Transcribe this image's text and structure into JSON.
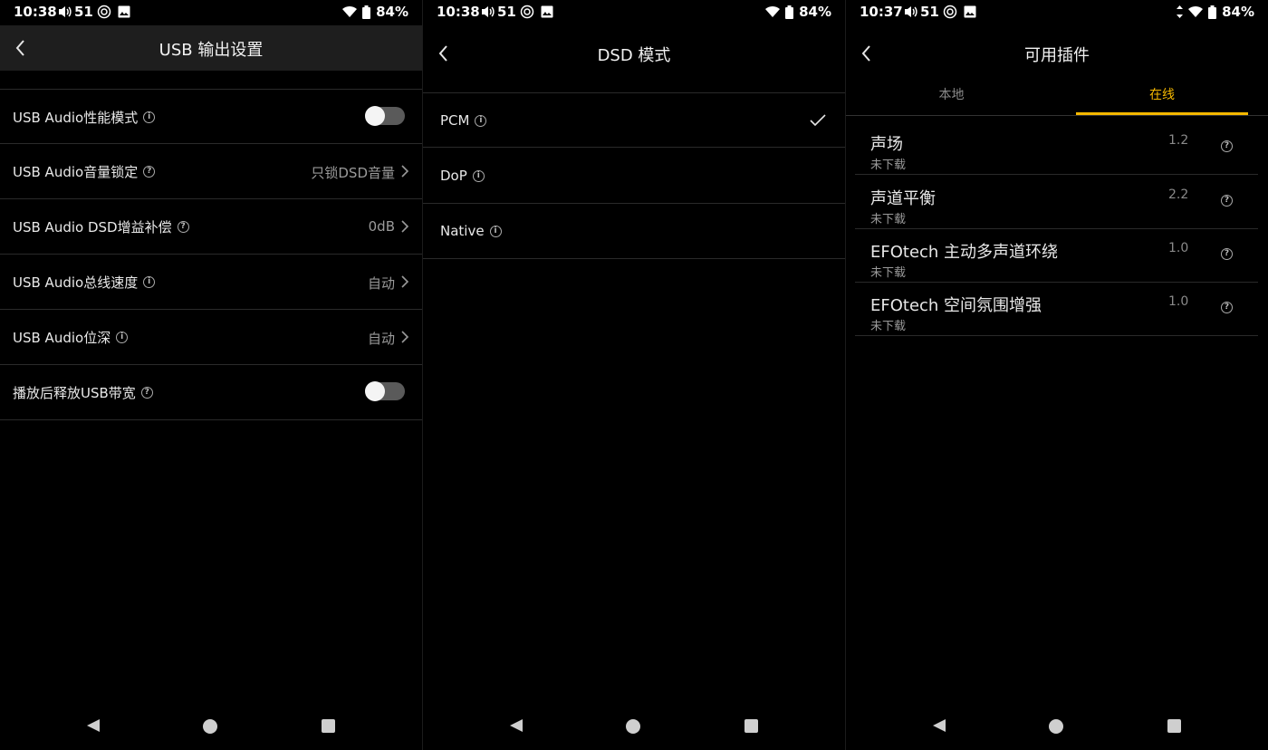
{
  "panels": [
    {
      "status": {
        "time": "10:38",
        "volume": "51",
        "battery": "84%"
      },
      "header": {
        "title": "USB 输出设置"
      },
      "rows": [
        {
          "label": "USB Audio性能模式",
          "badge": "i",
          "value": ""
        },
        {
          "label": "USB Audio音量锁定",
          "badge": "?",
          "value": "只锁DSD音量"
        },
        {
          "label": "USB Audio DSD增益补偿",
          "badge": "?",
          "value": "0dB"
        },
        {
          "label": "USB Audio总线速度",
          "badge": "i",
          "value": "自动"
        },
        {
          "label": "USB Audio位深",
          "badge": "i",
          "value": "自动"
        },
        {
          "label": "播放后释放USB带宽",
          "badge": "?",
          "value": ""
        }
      ]
    },
    {
      "status": {
        "time": "10:38",
        "volume": "51",
        "battery": "84%"
      },
      "header": {
        "title": "DSD 模式"
      },
      "options": [
        {
          "label": "PCM",
          "badge": "i",
          "selected": true
        },
        {
          "label": "DoP",
          "badge": "i",
          "selected": false
        },
        {
          "label": "Native",
          "badge": "i",
          "selected": false
        }
      ]
    },
    {
      "status": {
        "time": "10:37",
        "volume": "51",
        "battery": "84%"
      },
      "header": {
        "title": "可用插件"
      },
      "tabs": [
        {
          "label": "本地",
          "active": false
        },
        {
          "label": "在线",
          "active": true
        }
      ],
      "plugins": [
        {
          "name": "声场",
          "status": "未下载",
          "version": "1.2"
        },
        {
          "name": "声道平衡",
          "status": "未下载",
          "version": "2.2"
        },
        {
          "name": "EFOtech 主动多声道环绕",
          "status": "未下载",
          "version": "1.0"
        },
        {
          "name": "EFOtech 空间氛围增强",
          "status": "未下载",
          "version": "1.0"
        }
      ]
    }
  ],
  "theme": {
    "accent": "#f5b800",
    "background": "#000000",
    "header": "#1e1e1e"
  },
  "icons": [
    "back-icon",
    "chevron-right-icon",
    "info-icon",
    "help-icon",
    "check-icon",
    "wifi-icon",
    "battery-icon",
    "volume-icon",
    "image-icon"
  ]
}
